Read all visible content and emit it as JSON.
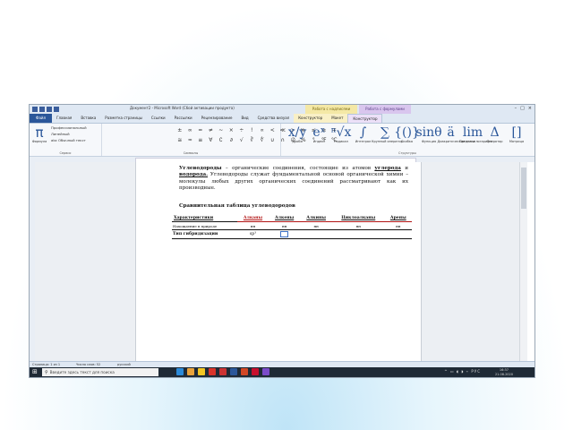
{
  "window": {
    "title": "Документ2 - Microsoft Word (Сбой активации продукта)",
    "context_tab_1": "Работа с надписями",
    "context_tab_2": "Работа с формулами",
    "controls": [
      "–",
      "□",
      "×"
    ]
  },
  "ribbon": {
    "tabs": [
      "Файл",
      "Главная",
      "Вставка",
      "Разметка страницы",
      "Ссылки",
      "Рассылки",
      "Рецензирование",
      "Вид",
      "Средства визуал",
      "Конструктор",
      "Макет",
      "Конструктор"
    ],
    "active_tab_index": 11,
    "service": {
      "formula_label": "Формула",
      "items": [
        "Профессиональный",
        "Линейный",
        "abc Обычный текст"
      ],
      "group_label": "Сервис"
    },
    "symbols": {
      "group_label": "Символы",
      "glyphs": [
        "±",
        "∞",
        "=",
        "≠",
        "~",
        "×",
        "÷",
        "!",
        "∝",
        "<",
        "≪",
        ">",
        "≫",
        "≤",
        "≥",
        "∓",
        "≅",
        "≈",
        "≡",
        "∀",
        "∁",
        "∂",
        "√",
        "∛",
        "∜",
        "∪",
        "∩",
        "∅",
        "%",
        "°",
        "℉",
        "℃"
      ]
    },
    "structures": {
      "group_label": "Структуры",
      "items": [
        {
          "glyph": "x/y",
          "label": "Дробь"
        },
        {
          "glyph": "eˣ",
          "label": "Индекс"
        },
        {
          "glyph": "ⁿ√x",
          "label": "Радикал"
        },
        {
          "glyph": "∫",
          "label": "Интеграл"
        },
        {
          "glyph": "∑",
          "label": "Крупный оператор"
        },
        {
          "glyph": "{()}",
          "label": "Скобка"
        },
        {
          "glyph": "sinθ",
          "label": "Функция"
        },
        {
          "glyph": "ä",
          "label": "Диакритические знаки"
        },
        {
          "glyph": "lim",
          "label": "Предел и логарифм"
        },
        {
          "glyph": "Δ",
          "label": "Оператор"
        },
        {
          "glyph": "[]",
          "label": "Матрица"
        }
      ]
    }
  },
  "document": {
    "paragraph": {
      "term": "Углеводороды",
      "text1": " – органические соединения, состоящие из атомов ",
      "u1": "углерода",
      "text2": " и ",
      "u2": "водорода.",
      "text3": " Углеводороды служат фундаментальной основой органической химии – молекулы любых других органических соединений рассматривают как их производные."
    },
    "table_title": "Сравнительная таблица углеводородов",
    "table": {
      "headers": [
        "Характеристики",
        "Алканы",
        "Алкены",
        "Алкины",
        "Циклоалканы",
        "Арены"
      ],
      "subrow": [
        "Нахождение в природе",
        "нн",
        "нн",
        "нн",
        "нн",
        "нн"
      ],
      "row": [
        "Тип гибридизации",
        "sp³",
        "",
        "",
        "",
        ""
      ]
    }
  },
  "statusbar": {
    "page": "Страница: 1 из 1",
    "words": "Число слов: 52",
    "lang": "русский"
  },
  "taskbar": {
    "search_placeholder": "Введите здесь текст для поиска",
    "time": "16:37",
    "date": "21.08.2020"
  },
  "colors": {
    "accent": "#2b579a",
    "red_header": "#b21414",
    "ctx1": "#f4e8a6",
    "ctx2": "#d9c6ee"
  }
}
